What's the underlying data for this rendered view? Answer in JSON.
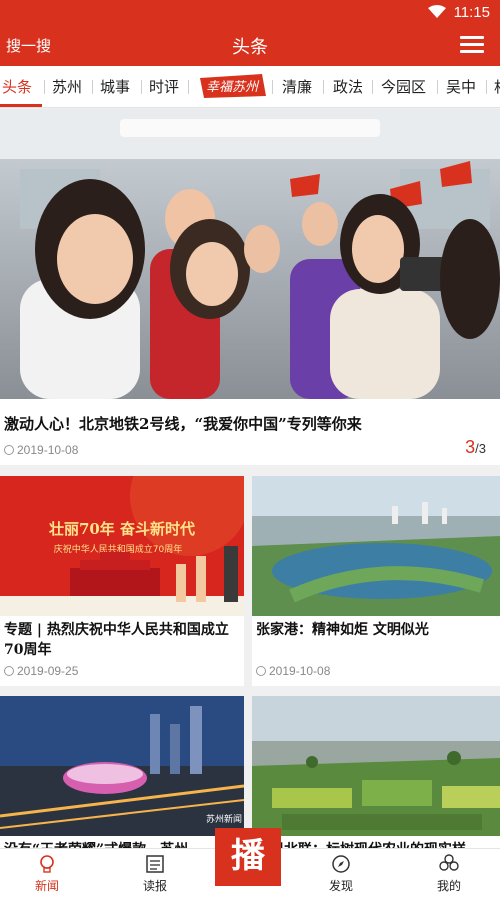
{
  "status": {
    "time": "11:15"
  },
  "header": {
    "search_label": "搜一搜",
    "title": "头条"
  },
  "tabs": [
    {
      "label": "头条"
    },
    {
      "label": "苏州"
    },
    {
      "label": "城事"
    },
    {
      "label": "时评"
    },
    {
      "label": "清廉"
    },
    {
      "label": "政法"
    },
    {
      "label": "今园区"
    },
    {
      "label": "吴中"
    },
    {
      "label": "相"
    }
  ],
  "special_tab": {
    "text": "幸福苏州"
  },
  "hero": {
    "title": "激动人心！北京地铁2号线，“我爱你中国”专列等你来",
    "date": "2019-10-08",
    "pager_current": "3",
    "pager_total": "/3"
  },
  "cards": [
    {
      "title": "专题 | 热烈庆祝中华人民共和国成立70周年",
      "date": "2019-09-25",
      "banner_main": "壮丽70年 奋斗新时代",
      "banner_sub": "庆祝中华人民共和国成立70周年"
    },
    {
      "title": "张家港：精神如炬 文明似光",
      "date": "2019-10-08"
    },
    {
      "title": "没有“王者荣耀”式爆款，苏州",
      "date": ""
    },
    {
      "title": "同里北联：标树现代农业的现实样",
      "date": ""
    }
  ],
  "watermark": "苏州新闻",
  "bottom_nav": {
    "news": "新闻",
    "read": "读报",
    "center": "播",
    "discover": "发现",
    "mine": "我的"
  },
  "colors": {
    "brand": "#d8321f"
  }
}
